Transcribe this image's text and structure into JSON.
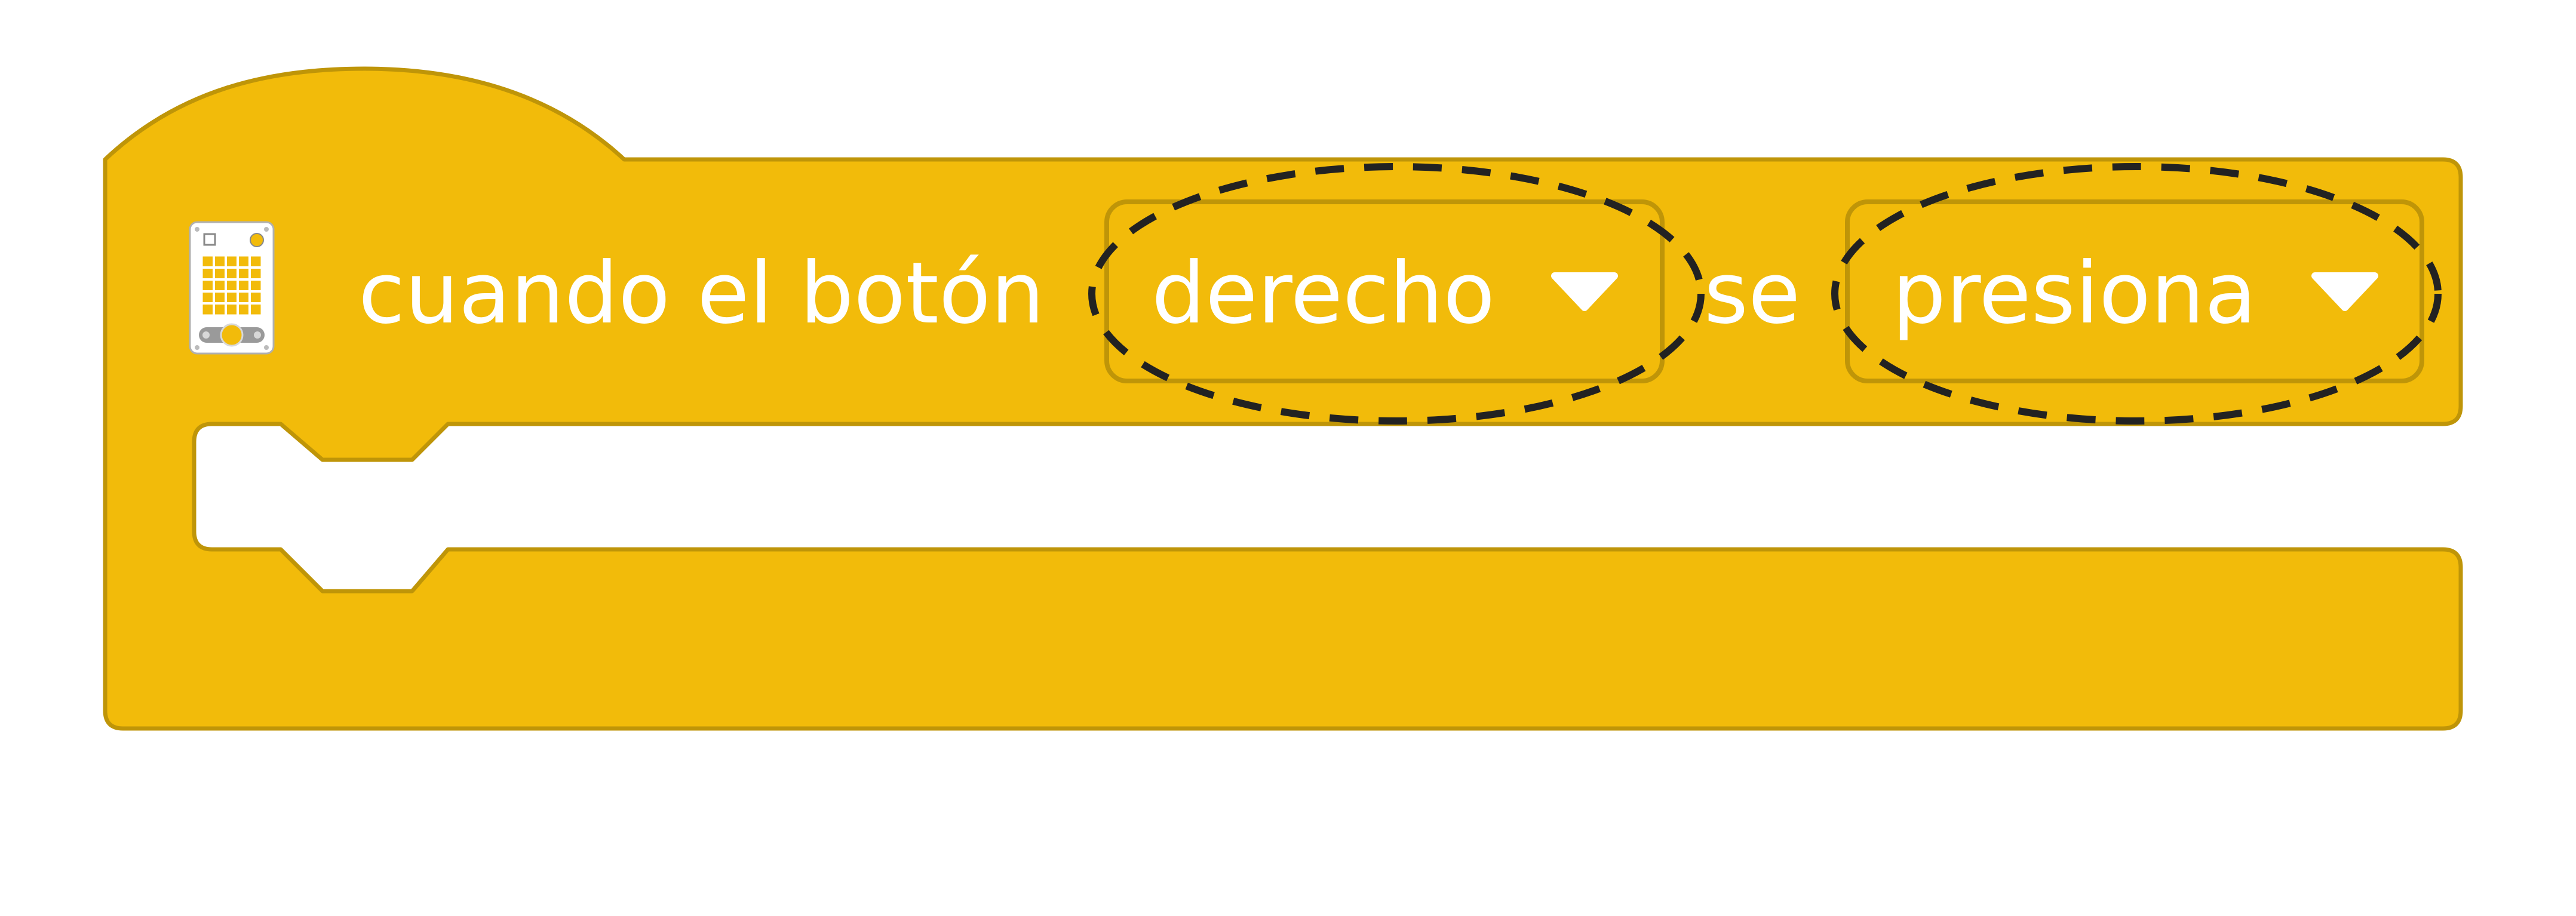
{
  "block": {
    "label_prefix": "cuando el botón",
    "label_middle": "se",
    "button_dropdown": {
      "selected": "derecho",
      "icon": "triangle-down-icon"
    },
    "action_dropdown": {
      "selected": "presiona",
      "icon": "triangle-down-icon"
    },
    "category_icon": "hub-device-icon"
  },
  "colors": {
    "block_fill": "#f2bb0a",
    "block_stroke": "#bf9508",
    "text": "#ffffff",
    "highlight_outline": "#222222"
  }
}
